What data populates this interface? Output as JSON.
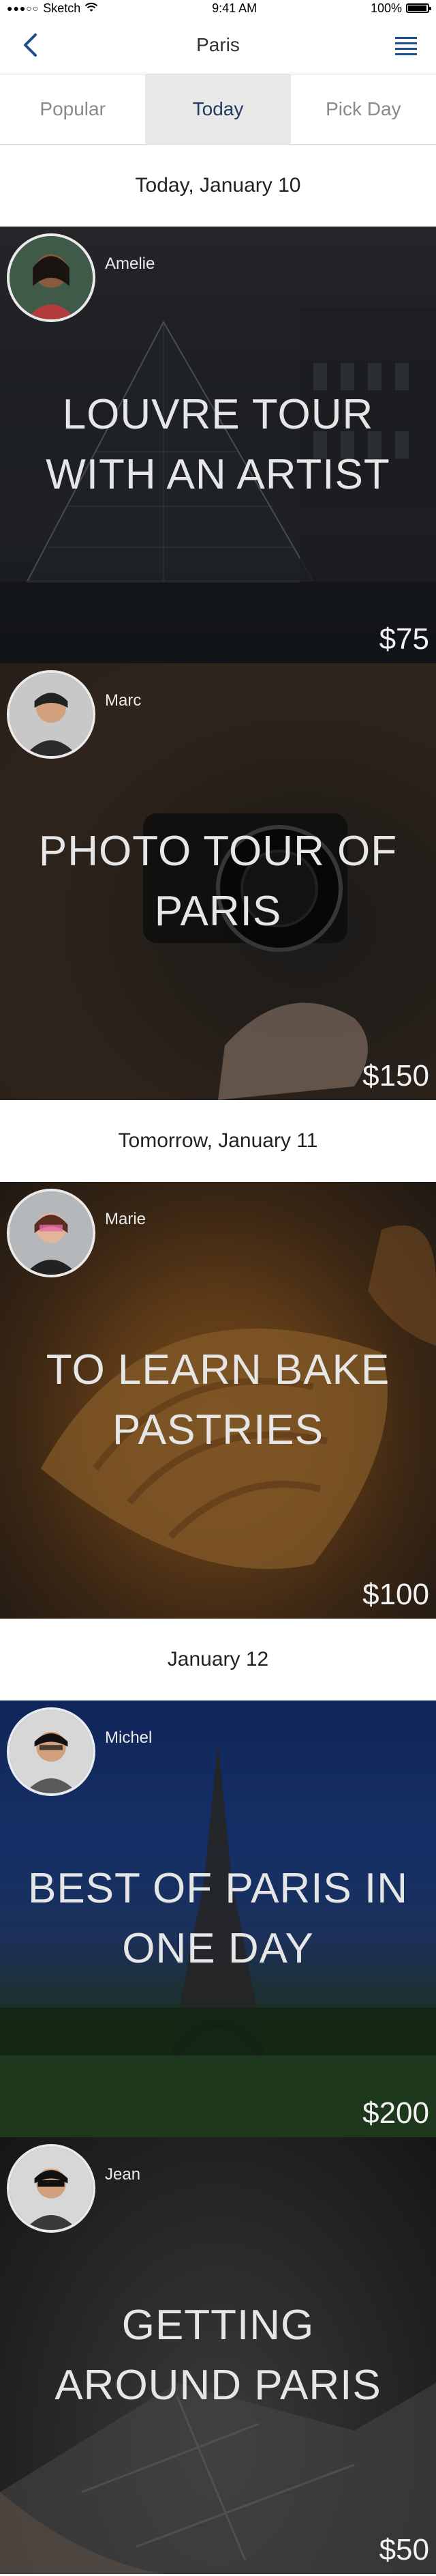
{
  "status_bar": {
    "carrier": "Sketch",
    "time": "9:41 AM",
    "battery": "100%"
  },
  "nav": {
    "title": "Paris"
  },
  "tabs": [
    {
      "label": "Popular",
      "active": false
    },
    {
      "label": "Today",
      "active": true
    },
    {
      "label": "Pick Day",
      "active": false
    }
  ],
  "sections": [
    {
      "date": "Today, January 10",
      "cards": [
        {
          "host": "Amelie",
          "title": "LOUVRE TOUR WITH AN ARTIST",
          "price": "$75"
        },
        {
          "host": "Marc",
          "title": "PHOTO TOUR OF PARIS",
          "price": "$150"
        }
      ]
    },
    {
      "date": "Tomorrow, January 11",
      "cards": [
        {
          "host": "Marie",
          "title": "TO LEARN BAKE PASTRIES",
          "price": "$100"
        }
      ]
    },
    {
      "date": "January 12",
      "cards": [
        {
          "host": "Michel",
          "title": "BEST OF PARIS IN ONE DAY",
          "price": "$200"
        },
        {
          "host": "Jean",
          "title": "GETTING AROUND PARIS",
          "price": "$50"
        }
      ]
    }
  ],
  "colors": {
    "accent": "#1f4e8c",
    "tab_active_bg": "#e8e8e8"
  },
  "icons": {
    "back": "chevron-left-icon",
    "menu": "hamburger-menu-icon",
    "wifi": "wifi-icon",
    "battery": "battery-icon",
    "signal": "signal-dots-icon"
  }
}
